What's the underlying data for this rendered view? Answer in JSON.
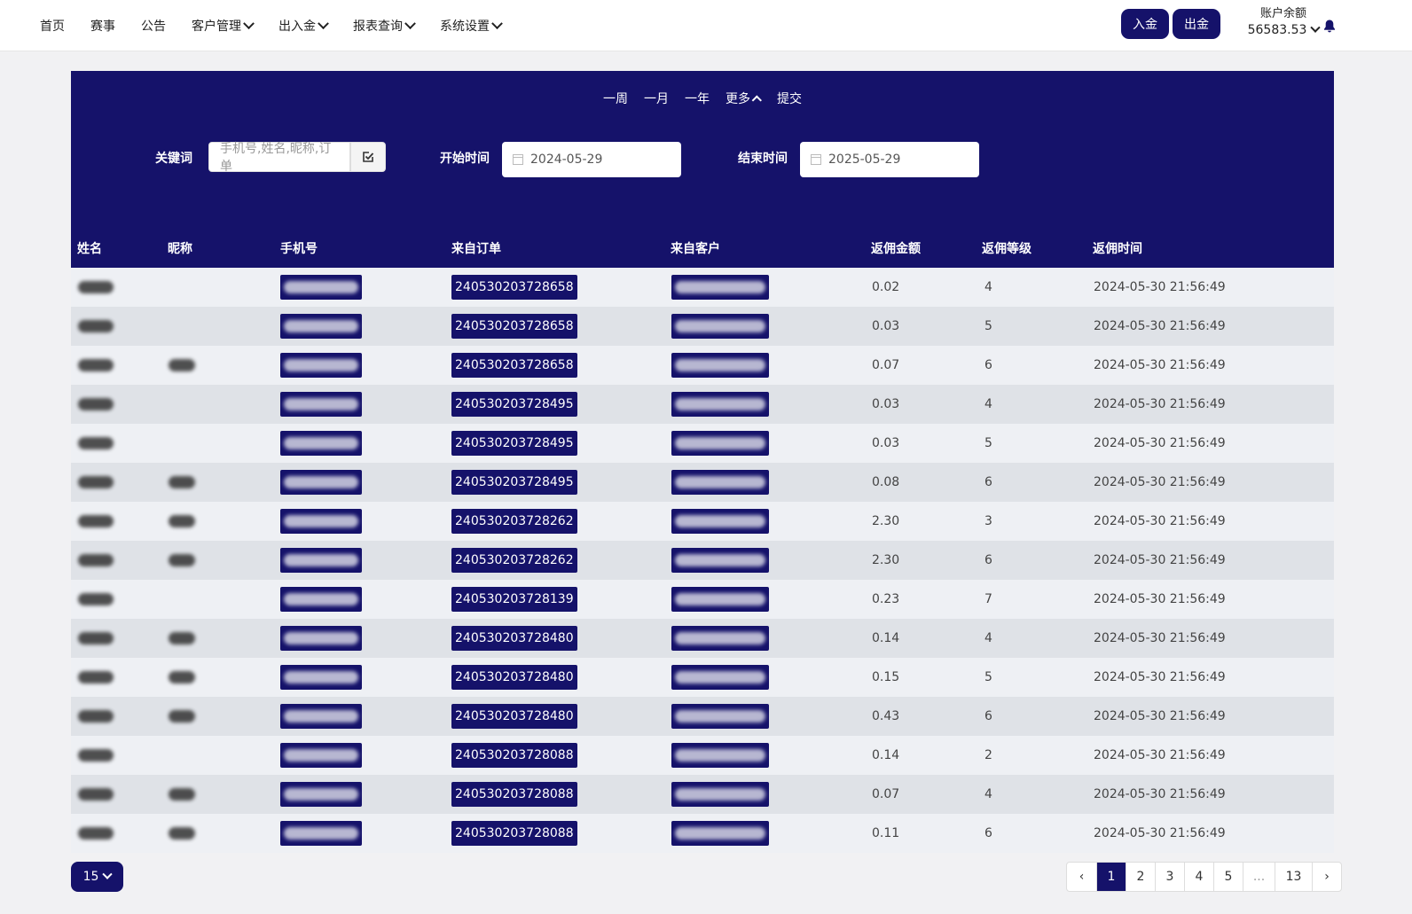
{
  "nav": {
    "items": [
      {
        "label": "首页",
        "dropdown": false
      },
      {
        "label": "赛事",
        "dropdown": false
      },
      {
        "label": "公告",
        "dropdown": false
      },
      {
        "label": "客户管理",
        "dropdown": true
      },
      {
        "label": "出入金",
        "dropdown": true
      },
      {
        "label": "报表查询",
        "dropdown": true
      },
      {
        "label": "系统设置",
        "dropdown": true
      }
    ]
  },
  "header": {
    "deposit_label": "入金",
    "withdraw_label": "出金",
    "balance_label": "账户余额",
    "balance_value": "56583.53"
  },
  "filters": {
    "quick": [
      "一周",
      "一月",
      "一年",
      "更多",
      "提交"
    ],
    "keyword_label": "关键词",
    "keyword_placeholder": "手机号,姓名,昵称,订单",
    "start_label": "开始时间",
    "start_value": "2024-05-29",
    "end_label": "结束时间",
    "end_value": "2025-05-29"
  },
  "table": {
    "headers": [
      "姓名",
      "昵称",
      "手机号",
      "来自订单",
      "来自客户",
      "返佣金额",
      "返佣等级",
      "返佣时间"
    ],
    "rows": [
      {
        "order": "240530203728658",
        "amount": "0.02",
        "level": "4",
        "time": "2024-05-30 21:56:49",
        "nick": false
      },
      {
        "order": "240530203728658",
        "amount": "0.03",
        "level": "5",
        "time": "2024-05-30 21:56:49",
        "nick": false
      },
      {
        "order": "240530203728658",
        "amount": "0.07",
        "level": "6",
        "time": "2024-05-30 21:56:49",
        "nick": true
      },
      {
        "order": "240530203728495",
        "amount": "0.03",
        "level": "4",
        "time": "2024-05-30 21:56:49",
        "nick": false
      },
      {
        "order": "240530203728495",
        "amount": "0.03",
        "level": "5",
        "time": "2024-05-30 21:56:49",
        "nick": false
      },
      {
        "order": "240530203728495",
        "amount": "0.08",
        "level": "6",
        "time": "2024-05-30 21:56:49",
        "nick": true
      },
      {
        "order": "240530203728262",
        "amount": "2.30",
        "level": "3",
        "time": "2024-05-30 21:56:49",
        "nick": true
      },
      {
        "order": "240530203728262",
        "amount": "2.30",
        "level": "6",
        "time": "2024-05-30 21:56:49",
        "nick": true
      },
      {
        "order": "240530203728139",
        "amount": "0.23",
        "level": "7",
        "time": "2024-05-30 21:56:49",
        "nick": false
      },
      {
        "order": "240530203728480",
        "amount": "0.14",
        "level": "4",
        "time": "2024-05-30 21:56:49",
        "nick": true
      },
      {
        "order": "240530203728480",
        "amount": "0.15",
        "level": "5",
        "time": "2024-05-30 21:56:49",
        "nick": true
      },
      {
        "order": "240530203728480",
        "amount": "0.43",
        "level": "6",
        "time": "2024-05-30 21:56:49",
        "nick": true
      },
      {
        "order": "240530203728088",
        "amount": "0.14",
        "level": "2",
        "time": "2024-05-30 21:56:49",
        "nick": false
      },
      {
        "order": "240530203728088",
        "amount": "0.07",
        "level": "4",
        "time": "2024-05-30 21:56:49",
        "nick": true
      },
      {
        "order": "240530203728088",
        "amount": "0.11",
        "level": "6",
        "time": "2024-05-30 21:56:49",
        "nick": true
      }
    ]
  },
  "pagination": {
    "page_size": "15",
    "prev": "‹",
    "next": "›",
    "pages": [
      "1",
      "2",
      "3",
      "4",
      "5",
      "...",
      "13"
    ],
    "active": "1"
  },
  "colors": {
    "primary": "#15126a",
    "row_odd": "#eef0f4",
    "row_even": "#dfe2e7"
  }
}
